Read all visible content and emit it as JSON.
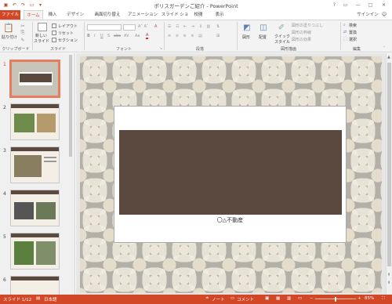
{
  "window": {
    "title": "ポリスガーデンご紹介 - PowerPoint"
  },
  "qat": [
    {
      "icon": "save-icon",
      "glyph": "▣"
    },
    {
      "icon": "undo-icon",
      "glyph": "↶"
    },
    {
      "icon": "redo-icon",
      "glyph": "↷"
    },
    {
      "icon": "start-presentation-icon",
      "glyph": "▭"
    },
    {
      "icon": "customize-icon",
      "glyph": "▾"
    }
  ],
  "window_controls": {
    "help": "?",
    "ribbon": "▭",
    "min": "—",
    "max": "□",
    "close": "✕"
  },
  "tabs": [
    "ファイル",
    "ホーム",
    "挿入",
    "デザイン",
    "画面切り替え",
    "アニメーション",
    "スライド ショー",
    "校閲",
    "表示"
  ],
  "active_tab": "ホーム",
  "signin": "サインイン",
  "ribbon": {
    "clipboard": {
      "paste": "貼り付け",
      "label": "クリップボード"
    },
    "slides": {
      "new_slide": "新しい",
      "new_slide2": "スライド",
      "layout": "レイアウト",
      "reset": "リセット",
      "section": "セクション",
      "label": "スライド"
    },
    "font": {
      "label": "フォント",
      "bold": "B",
      "italic": "I",
      "underline": "U",
      "shadow": "S",
      "strike": "abc",
      "spacing": "AV",
      "case": "Aa",
      "color": "A"
    },
    "paragraph": {
      "label": "段落"
    },
    "drawing": {
      "shape": "図形",
      "arrange": "配置",
      "quick_style1": "クイック",
      "quick_style2": "スタイル",
      "fill": "図形の塗りつぶし",
      "outline": "図形の枠線",
      "effects": "図形の効果",
      "label": "図形描画"
    },
    "editing": {
      "find": "検索",
      "replace": "置換",
      "select": "選択",
      "label": "編集"
    }
  },
  "slides": [
    {
      "num": "1"
    },
    {
      "num": "2"
    },
    {
      "num": "3"
    },
    {
      "num": "4"
    },
    {
      "num": "5"
    },
    {
      "num": "6"
    }
  ],
  "slide": {
    "company": "〇△不動産"
  },
  "status": {
    "slide": "スライド 1/12",
    "lang": "日本語",
    "notes": "ノート",
    "comments": "コメント",
    "zoom": "85%"
  },
  "colors": {
    "accent": "#d24726",
    "band": "#5b4940"
  }
}
